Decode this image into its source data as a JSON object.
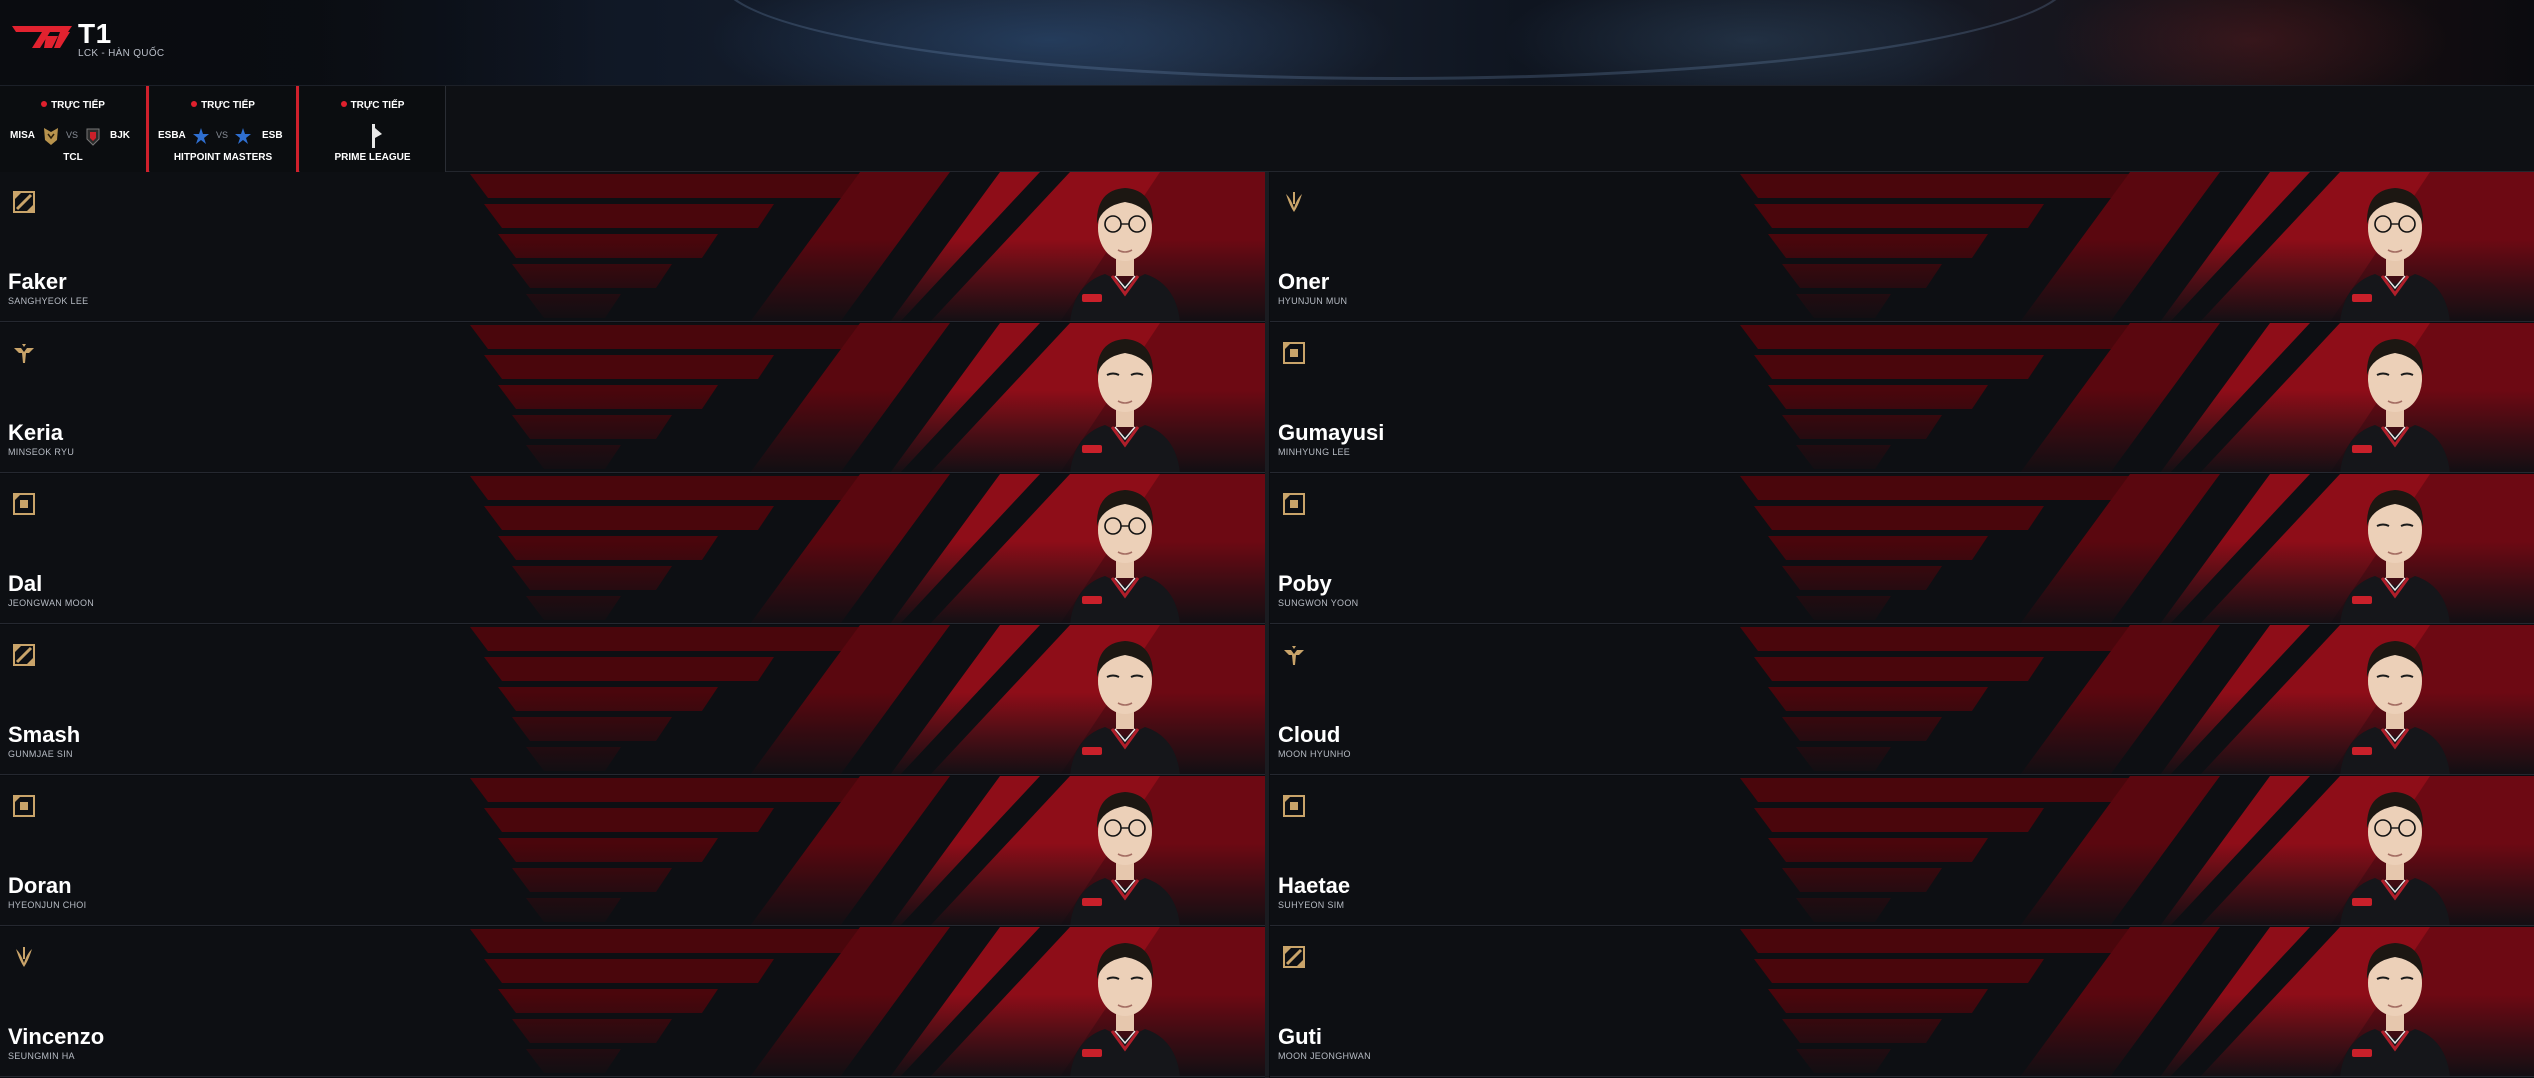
{
  "header": {
    "team_name": "T1",
    "league": "LCK - HÀN QUỐC"
  },
  "live_matches": [
    {
      "status": "TRỰC TIẾP",
      "team1": "MISA",
      "vs": "VS",
      "team2": "BJK",
      "tournament": "TCL"
    },
    {
      "status": "TRỰC TIẾP",
      "team1": "ESBA",
      "vs": "VS",
      "team2": "ESB",
      "tournament": "HITPOINT MASTERS"
    },
    {
      "status": "TRỰC TIẾP",
      "tournament": "PRIME LEAGUE"
    }
  ],
  "players": [
    {
      "nickname": "Faker",
      "real_name": "SANGHYEOK LEE",
      "role_icon": "mid-lane-icon",
      "glasses": true
    },
    {
      "nickname": "Oner",
      "real_name": "HYUNJUN MUN",
      "role_icon": "jungle-icon",
      "glasses": true
    },
    {
      "nickname": "Keria",
      "real_name": "MINSEOK RYU",
      "role_icon": "support-icon",
      "glasses": false
    },
    {
      "nickname": "Gumayusi",
      "real_name": "MINHYUNG LEE",
      "role_icon": "bot-lane-icon",
      "glasses": false
    },
    {
      "nickname": "Dal",
      "real_name": "JEONGWAN MOON",
      "role_icon": "bot-lane-icon",
      "glasses": true
    },
    {
      "nickname": "Poby",
      "real_name": "SUNGWON YOON",
      "role_icon": "bot-lane-icon",
      "glasses": false
    },
    {
      "nickname": "Smash",
      "real_name": "GUNMJAE SIN",
      "role_icon": "mid-lane-icon",
      "glasses": false
    },
    {
      "nickname": "Cloud",
      "real_name": "MOON HYUNHO",
      "role_icon": "support-icon",
      "glasses": false
    },
    {
      "nickname": "Doran",
      "real_name": "HYEONJUN CHOI",
      "role_icon": "bot-lane-icon",
      "glasses": true
    },
    {
      "nickname": "Haetae",
      "real_name": "SUHYEON SIM",
      "role_icon": "bot-lane-icon",
      "glasses": true
    },
    {
      "nickname": "Vincenzo",
      "real_name": "SEUNGMIN HA",
      "role_icon": "jungle-icon",
      "glasses": false
    },
    {
      "nickname": "Guti",
      "real_name": "MOON JEONGHWAN",
      "role_icon": "mid-lane-icon",
      "glasses": false
    }
  ],
  "colors": {
    "accent_red": "#d0202c",
    "stripe_dark_red": "#4a060c",
    "stripe_red": "#8e0d18",
    "gold": "#c9a46a",
    "card_bg": "#0d0f13"
  }
}
